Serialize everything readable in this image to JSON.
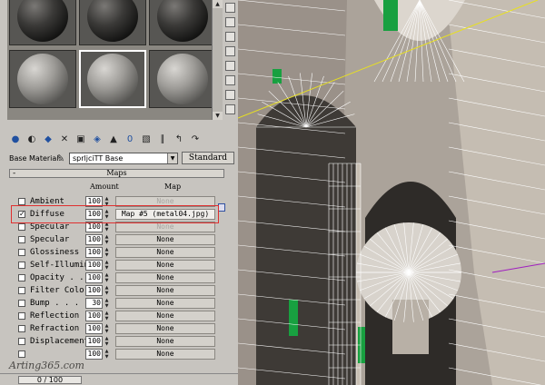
{
  "material_editor": {
    "toolbar_icons": [
      "get-material-icon",
      "put-material-icon",
      "assign-material-icon",
      "reset-icon",
      "copy-material-icon",
      "make-unique-icon",
      "put-to-library-icon",
      "material-effects-channel-icon",
      "show-map-icon",
      "show-end-result-icon",
      "go-parent-icon",
      "go-sibling-icon"
    ],
    "base_material_label": "Base Material:",
    "base_material_value": "sprljciTT Base",
    "standard_button": "Standard",
    "rollout_minus": "-",
    "rollout_title": "Maps",
    "amount_header": "Amount",
    "map_header": "Map",
    "maps": [
      {
        "name": "Ambient",
        "checked": false,
        "amount": "100",
        "map": "None",
        "map_dim": true
      },
      {
        "name": "Diffuse",
        "checked": true,
        "amount": "100",
        "map": "Map #5 (metal04.jpg)",
        "map_dim": false
      },
      {
        "name": "Specular",
        "checked": false,
        "amount": "100",
        "map": "None",
        "map_dim": true
      },
      {
        "name": "Specular",
        "checked": false,
        "amount": "100",
        "map": "None",
        "map_dim": false
      },
      {
        "name": "Glossiness",
        "checked": false,
        "amount": "100",
        "map": "None",
        "map_dim": false
      },
      {
        "name": "Self-Illumin",
        "checked": false,
        "amount": "100",
        "map": "None",
        "map_dim": false
      },
      {
        "name": "Opacity . .",
        "checked": false,
        "amount": "100",
        "map": "None",
        "map_dim": false
      },
      {
        "name": "Filter Color",
        "checked": false,
        "amount": "100",
        "map": "None",
        "map_dim": false
      },
      {
        "name": "Bump . . .",
        "checked": false,
        "amount": "30",
        "map": "None",
        "map_dim": false
      },
      {
        "name": "Reflection",
        "checked": false,
        "amount": "100",
        "map": "None",
        "map_dim": false
      },
      {
        "name": "Refraction",
        "checked": false,
        "amount": "100",
        "map": "None",
        "map_dim": false
      },
      {
        "name": "Displacement",
        "checked": false,
        "amount": "100",
        "map": "None",
        "map_dim": false
      },
      {
        "name": "",
        "checked": false,
        "amount": "100",
        "map": "None",
        "map_dim": false
      }
    ],
    "watermark": "Arting365.com",
    "status_progress": "0 / 100"
  },
  "colors": {
    "panel_bg": "#c7c4bf",
    "highlight_box": "#e03030",
    "wire_white": "#ffffff",
    "wire_green": "#20c040"
  }
}
